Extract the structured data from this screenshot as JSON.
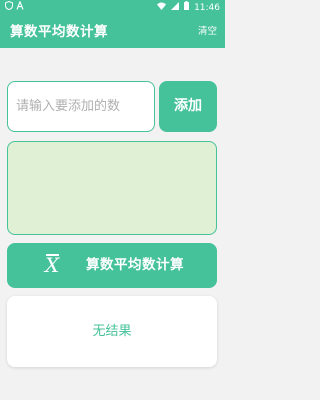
{
  "status_bar": {
    "time": "11:46",
    "left_icons": [
      "shield-icon",
      "a-icon"
    ],
    "right_icons": [
      "wifi-icon",
      "signal-icon",
      "battery-icon"
    ]
  },
  "app_bar": {
    "title": "算数平均数计算",
    "clear_label": "清空"
  },
  "input": {
    "value": "",
    "placeholder": "请输入要添加的数"
  },
  "add_button": {
    "label": "添加"
  },
  "numbers_list": [],
  "calc_button": {
    "symbol": "X",
    "label": "算数平均数计算"
  },
  "result": {
    "text": "无结果"
  },
  "colors": {
    "accent": "#46c29a",
    "list_bg": "#dff0d4",
    "page_bg": "#f2f2f2"
  }
}
